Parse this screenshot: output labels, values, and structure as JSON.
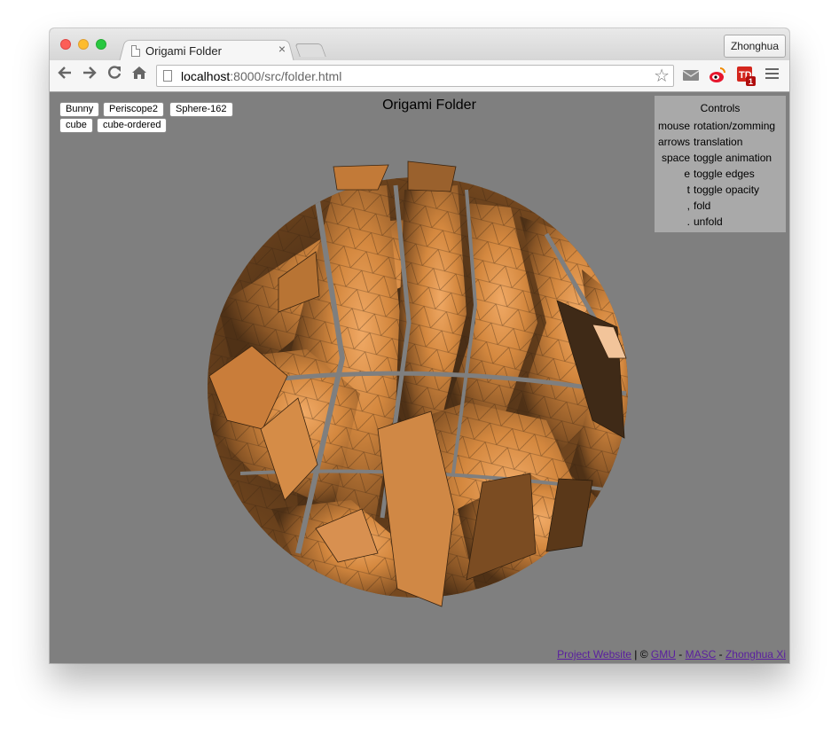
{
  "browser": {
    "tab_title": "Origami Folder",
    "tab_close": "×",
    "profile_name": "Zhonghua",
    "url_host": "localhost",
    "url_rest": ":8000/src/folder.html",
    "td_badge": "1"
  },
  "page": {
    "title": "Origami Folder",
    "models": [
      "Bunny",
      "Periscope2",
      "Sphere-162",
      "cube",
      "cube-ordered"
    ],
    "controls": {
      "title": "Controls",
      "rows": [
        {
          "key": "mouse",
          "desc": "rotation/zomming"
        },
        {
          "key": "arrows",
          "desc": "translation"
        },
        {
          "key": "space",
          "desc": "toggle animation"
        },
        {
          "key": "e",
          "desc": "toggle edges"
        },
        {
          "key": "t",
          "desc": "toggle opacity"
        },
        {
          "key": ",",
          "desc": "fold"
        },
        {
          "key": ".",
          "desc": "unfold"
        }
      ]
    },
    "footer": {
      "project_link": "Project Website",
      "sep1": " | © ",
      "gmu_link": "GMU",
      "sep2": " - ",
      "masc_link": "MASC",
      "sep3": " - ",
      "author_link": "Zhonghua Xi"
    }
  },
  "icons": {
    "back": "back-arrow-icon",
    "forward": "forward-arrow-icon",
    "reload": "reload-icon",
    "home": "home-icon",
    "star": "bookmark-star-icon",
    "mail": "mail-icon",
    "weibo": "weibo-icon",
    "td": "td-extension-icon",
    "menu": "menu-icon"
  },
  "colors": {
    "canvas_bg": "#7f7f7f",
    "paper_orange": "#d98c45",
    "controls_bg": "#a9a9a9",
    "link": "#5a1ea0"
  }
}
